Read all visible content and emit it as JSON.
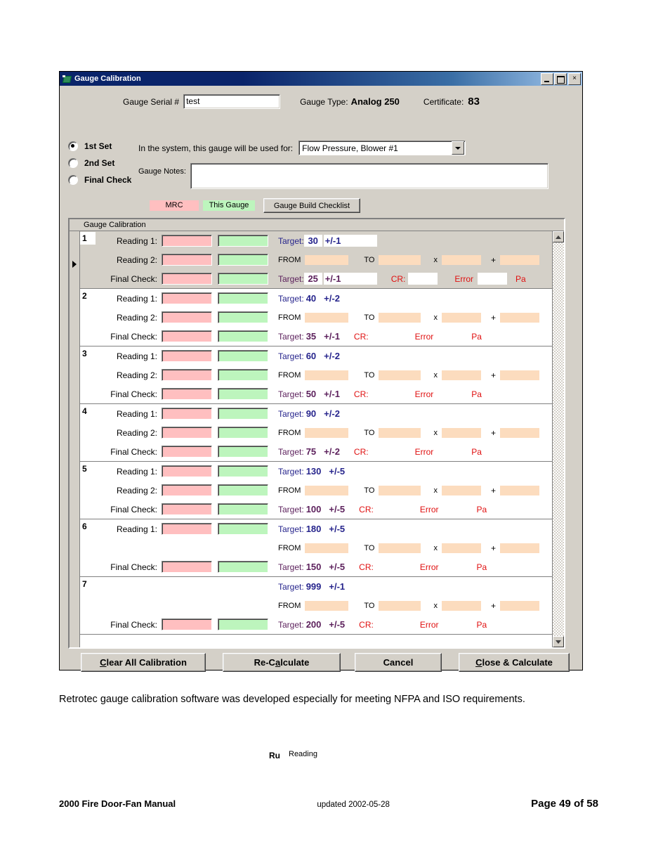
{
  "window": {
    "title": "Gauge Calibration",
    "icon": "app-icon",
    "buttons": {
      "minimize": "_",
      "maximize": "□",
      "close": "×"
    }
  },
  "form": {
    "serial_label": "Gauge Serial #",
    "serial_value": "test",
    "serial_placeholder": "",
    "gauge_type_label": "Gauge Type:",
    "gauge_type_value": "Analog 250",
    "certificate_label": "Certificate:",
    "certificate_value": "83",
    "sets": [
      {
        "label": "1st Set",
        "selected": true
      },
      {
        "label": "2nd Set",
        "selected": false
      },
      {
        "label": "Final Check",
        "selected": false
      }
    ],
    "used_for_label": "In the system, this gauge will be used for:",
    "used_for_value": "Flow Pressure, Blower #1",
    "notes_label": "Gauge Notes:",
    "notes_value": "",
    "notes_placeholder": ""
  },
  "legend": {
    "mrc": "MRC",
    "this_gauge": "This Gauge",
    "checklist_button": "Gauge Build Checklist"
  },
  "grid": {
    "header": "Gauge Calibration",
    "labels": {
      "reading1": "Reading 1:",
      "reading2": "Reading 2:",
      "final_check": "Final Check:",
      "target": "Target:",
      "from": "FROM",
      "to": "TO",
      "times": "x",
      "plus": "+",
      "cr": "CR:",
      "error": "Error",
      "pa": "Pa"
    },
    "rows": [
      {
        "n": "1",
        "selected": true,
        "has_reading1": true,
        "has_reading2": true,
        "r1_target": "30",
        "r1_tol": "+/-1",
        "r1_tol_value": "",
        "fc_target": "25",
        "fc_tol": "+/-1",
        "fc_tol_value": "",
        "cr_value": "",
        "error_value": ""
      },
      {
        "n": "2",
        "selected": false,
        "has_reading1": true,
        "has_reading2": true,
        "r1_target": "40",
        "r1_tol": "+/-2",
        "r1_tol_value": "",
        "fc_target": "35",
        "fc_tol": "+/-1",
        "fc_tol_value": "",
        "cr_value": "",
        "error_value": ""
      },
      {
        "n": "3",
        "selected": false,
        "has_reading1": true,
        "has_reading2": true,
        "r1_target": "60",
        "r1_tol": "+/-2",
        "r1_tol_value": "",
        "fc_target": "50",
        "fc_tol": "+/-1",
        "fc_tol_value": "",
        "cr_value": "",
        "error_value": ""
      },
      {
        "n": "4",
        "selected": false,
        "has_reading1": true,
        "has_reading2": true,
        "r1_target": "90",
        "r1_tol": "+/-2",
        "r1_tol_value": "",
        "fc_target": "75",
        "fc_tol": "+/-2",
        "fc_tol_value": "",
        "cr_value": "",
        "error_value": ""
      },
      {
        "n": "5",
        "selected": false,
        "has_reading1": true,
        "has_reading2": true,
        "r1_target": "130",
        "r1_tol": "+/-5",
        "r1_tol_value": "",
        "fc_target": "100",
        "fc_tol": "+/-5",
        "fc_tol_value": "",
        "cr_value": "",
        "error_value": ""
      },
      {
        "n": "6",
        "selected": false,
        "has_reading1": true,
        "has_reading2": false,
        "r1_target": "180",
        "r1_tol": "+/-5",
        "r1_tol_value": "",
        "fc_target": "150",
        "fc_tol": "+/-5",
        "fc_tol_value": "",
        "cr_value": "",
        "error_value": ""
      },
      {
        "n": "7",
        "selected": false,
        "has_reading1": false,
        "has_reading2": false,
        "r1_target": "999",
        "r1_tol": "+/-1",
        "r1_tol_value": "",
        "fc_target": "200",
        "fc_tol": "+/-5",
        "fc_tol_value": "",
        "cr_value": "",
        "error_value": ""
      }
    ]
  },
  "buttons": {
    "clear_all": "Clear All Calibration",
    "recalculate": "Re-Calculate",
    "cancel": "Cancel",
    "close_calculate": "Close & Calculate"
  },
  "status": {
    "ru": "Ru",
    "tooltip": "Reading"
  },
  "page": {
    "paragraph": "Retrotec gauge calibration software was developed especially for meeting NFPA and ISO requirements.",
    "footer_left": "2000 Fire Door-Fan Manual",
    "footer_mid": "updated 2002-05-28",
    "footer_right": "Page 49 of 58"
  },
  "colors": {
    "mrc_pink": "#ffbfc0",
    "this_gauge_green": "#bdf5bd",
    "calc_orange": "#fcdcbe",
    "reading_blue": "#26248c",
    "final_purple": "#5b1f5b",
    "error_red": "#e01010",
    "window_face": "#d4d0c8",
    "title_blue": "#0a246a"
  }
}
